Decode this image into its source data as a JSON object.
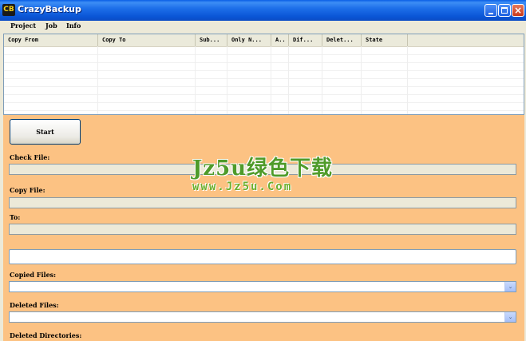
{
  "window": {
    "title": "CrazyBackup",
    "icon_text": "CB",
    "controls": [
      "minimize-icon",
      "maximize-icon",
      "close-icon"
    ],
    "close_glyph": "×"
  },
  "menu": [
    "Project",
    "Job",
    "Info"
  ],
  "table": {
    "columns": [
      "Copy From",
      "Copy To",
      "Sub...",
      "Only N...",
      "A..",
      "Dif...",
      "Delet...",
      "State"
    ],
    "rows": []
  },
  "panel": {
    "start_label": "Start",
    "check_file_label": "Check File:",
    "check_file_value": "",
    "copy_file_label": "Copy File:",
    "copy_file_value": "",
    "to_label": "To:",
    "to_value": "",
    "progress_text": "",
    "copied_files_label": "Copied Files:",
    "copied_files_value": "",
    "deleted_files_label": "Deleted Files:",
    "deleted_files_value": "",
    "deleted_dirs_label": "Deleted Directories:",
    "dropdown_glyph": "⌄"
  },
  "watermark": {
    "brand": "Jz5u绿色下载",
    "url": "www.Jz5u.Com"
  },
  "colors": {
    "panel_bg": "#fcc283",
    "titlebar": "#0a55d6",
    "watermark_green": "#4f9b2a"
  }
}
